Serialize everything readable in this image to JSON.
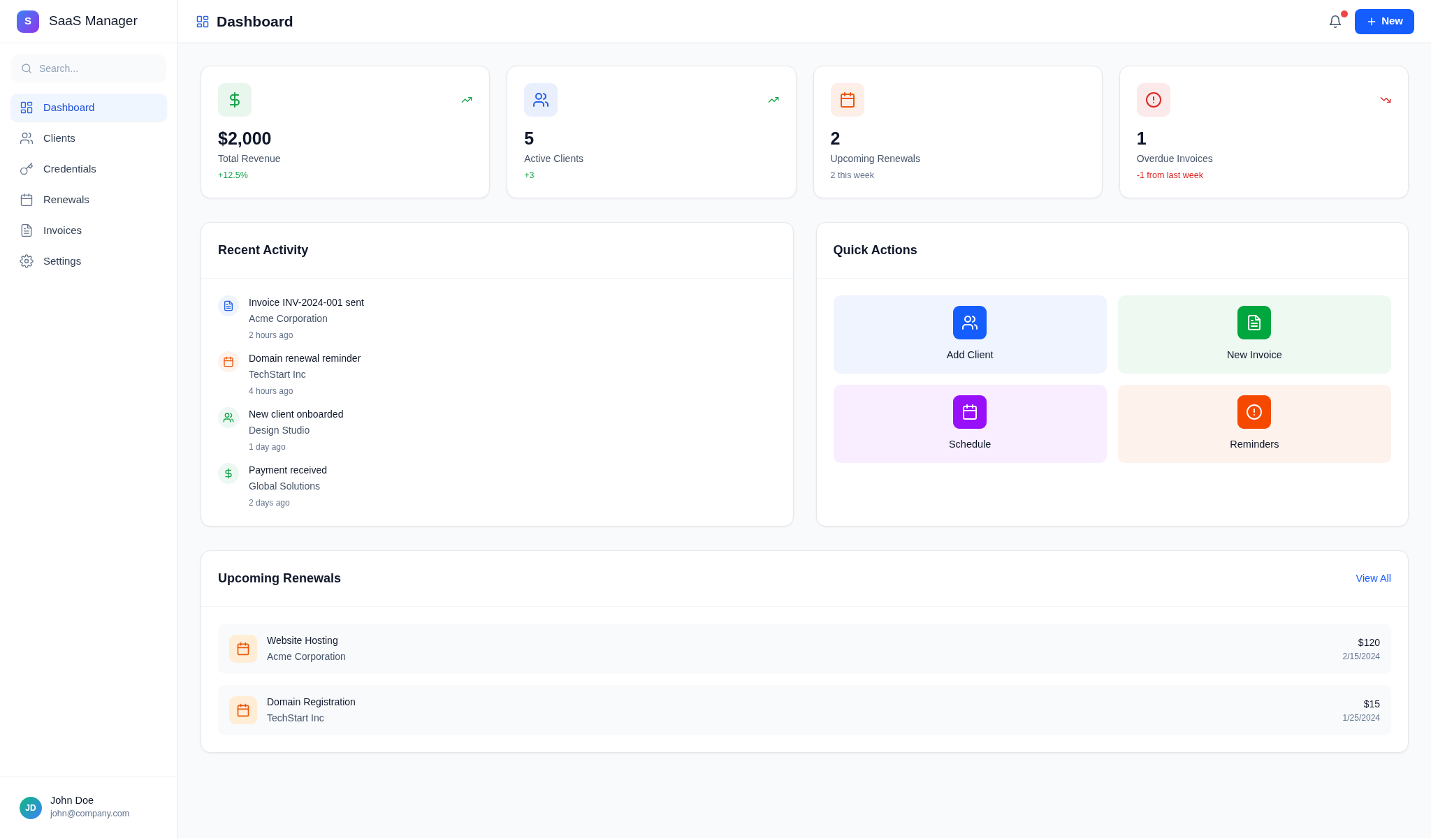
{
  "sidebar": {
    "logo_letter": "S",
    "app_name": "SaaS Manager",
    "search": {
      "placeholder": "Search..."
    },
    "items": [
      {
        "label": "Dashboard",
        "kind": "grid",
        "selected": true
      },
      {
        "label": "Clients",
        "kind": "users",
        "selected": false
      },
      {
        "label": "Credentials",
        "kind": "key",
        "selected": false
      },
      {
        "label": "Renewals",
        "kind": "calendar",
        "selected": false
      },
      {
        "label": "Invoices",
        "kind": "doc",
        "selected": false
      },
      {
        "label": "Settings",
        "kind": "gear",
        "selected": false
      }
    ],
    "user": {
      "initials": "JD",
      "name": "John Doe",
      "email": "john@company.com"
    }
  },
  "header": {
    "title": "Dashboard",
    "notification": true,
    "new_button": "New"
  },
  "stats": [
    {
      "kind": "dollar",
      "color": "#16a34a",
      "value": "$2,000",
      "label": "Total Revenue",
      "change": "+12.5%",
      "trend_up": true,
      "trend_down": false
    },
    {
      "kind": "users",
      "color": "#2563eb",
      "value": "5",
      "label": "Active Clients",
      "change": "+3",
      "trend_up": true,
      "trend_down": false
    },
    {
      "kind": "calendar",
      "color": "#ea580c",
      "value": "2",
      "label": "Upcoming Renewals",
      "change": "2 this week",
      "trend_up": false,
      "trend_down": false
    },
    {
      "kind": "alert",
      "color": "#dc2626",
      "value": "1",
      "label": "Overdue Invoices",
      "change": "-1 from last week",
      "trend_up": false,
      "trend_down": true
    }
  ],
  "recent_activity": {
    "title": "Recent Activity",
    "items": [
      {
        "kind": "doc",
        "color": "#2563eb",
        "title": "Invoice INV-2024-001 sent",
        "client": "Acme Corporation",
        "time": "2 hours ago"
      },
      {
        "kind": "calendar",
        "color": "#ea580c",
        "title": "Domain renewal reminder",
        "client": "TechStart Inc",
        "time": "4 hours ago"
      },
      {
        "kind": "users",
        "color": "#16a34a",
        "title": "New client onboarded",
        "client": "Design Studio",
        "time": "1 day ago"
      },
      {
        "kind": "dollar",
        "color": "#16a34a",
        "title": "Payment received",
        "client": "Global Solutions",
        "time": "2 days ago"
      }
    ]
  },
  "quick_actions": {
    "title": "Quick Actions",
    "items": [
      {
        "kind": "users",
        "color": "#155dfc",
        "label": "Add Client"
      },
      {
        "kind": "doc",
        "color": "#00a63e",
        "label": "New Invoice"
      },
      {
        "kind": "calendar",
        "color": "#9810fa",
        "label": "Schedule"
      },
      {
        "kind": "alert",
        "color": "#f54900",
        "label": "Reminders"
      }
    ]
  },
  "upcoming_renewals": {
    "title": "Upcoming Renewals",
    "view_all": "View All",
    "items": [
      {
        "name": "Website Hosting",
        "client": "Acme Corporation",
        "amount": "$120",
        "date": "2/15/2024"
      },
      {
        "name": "Domain Registration",
        "client": "TechStart Inc",
        "amount": "$15",
        "date": "1/25/2024"
      }
    ]
  }
}
